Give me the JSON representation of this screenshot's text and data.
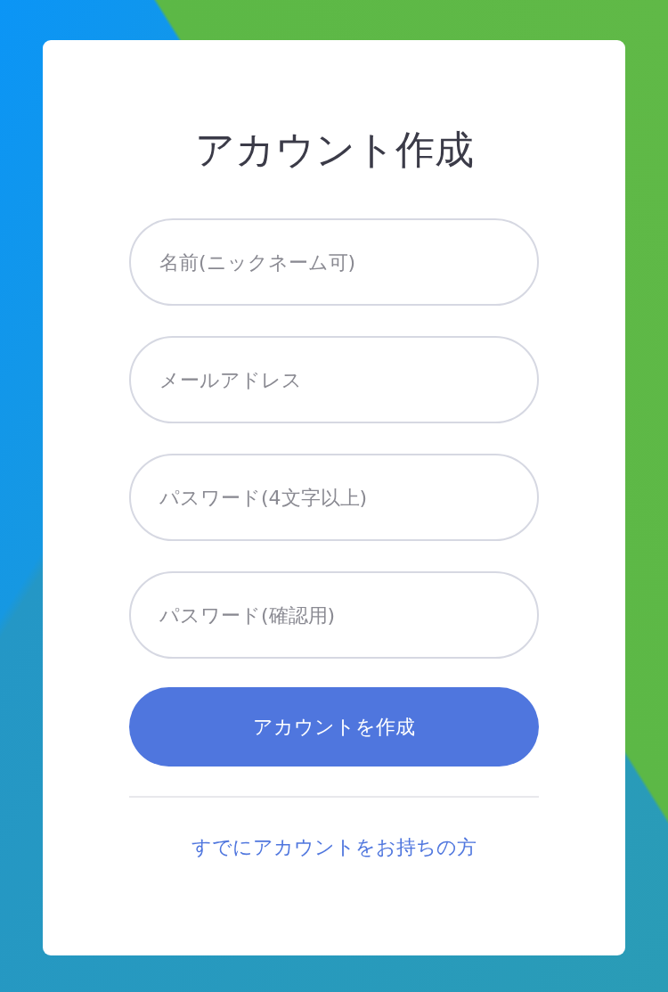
{
  "title": "アカウント作成",
  "fields": [
    {
      "placeholder": "名前(ニックネーム可)"
    },
    {
      "placeholder": "メールアドレス"
    },
    {
      "placeholder": "パスワード(4文字以上)"
    },
    {
      "placeholder": "パスワード(確認用)"
    }
  ],
  "submit_button": "アカウントを作成",
  "login_link": "すでにアカウントをお持ちの方"
}
